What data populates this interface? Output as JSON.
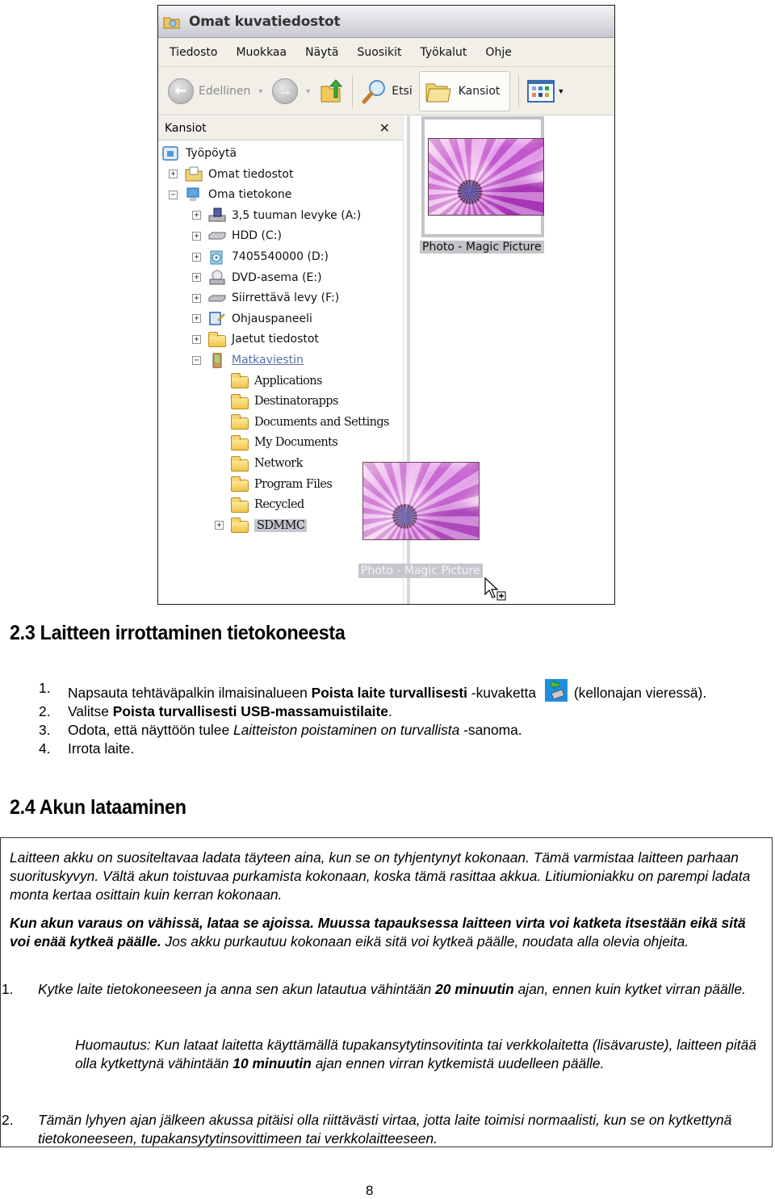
{
  "explorer": {
    "window_title": "Omat kuvatiedostot",
    "menu": [
      "Tiedosto",
      "Muokkaa",
      "Näytä",
      "Suosikit",
      "Työkalut",
      "Ohje"
    ],
    "toolbar": {
      "back_label": "Edellinen",
      "search_label": "Etsi",
      "folders_label": "Kansiot",
      "icons": [
        "back-arrow-icon",
        "forward-arrow-icon",
        "folder-up-icon",
        "search-magnifier-icon",
        "folders-icon",
        "views-icon"
      ]
    },
    "folder_pane": {
      "title": "Kansiot",
      "close_symbol": "✕",
      "tree": [
        {
          "label": "Työpöytä",
          "level": 0,
          "expander": "",
          "icon": "desktop-icon"
        },
        {
          "label": "Omat tiedostot",
          "level": 1,
          "expander": "+",
          "icon": "my-documents-icon"
        },
        {
          "label": "Oma tietokone",
          "level": 1,
          "expander": "−",
          "icon": "my-computer-icon"
        },
        {
          "label": "3,5 tuuman levyke (A:)",
          "level": 2,
          "expander": "+",
          "icon": "floppy-drive-icon"
        },
        {
          "label": "HDD (C:)",
          "level": 2,
          "expander": "+",
          "icon": "hard-drive-icon"
        },
        {
          "label": "7405540000 (D:)",
          "level": 2,
          "expander": "+",
          "icon": "cd-drive-icon"
        },
        {
          "label": "DVD-asema (E:)",
          "level": 2,
          "expander": "+",
          "icon": "dvd-drive-icon"
        },
        {
          "label": "Siirrettävä levy (F:)",
          "level": 2,
          "expander": "+",
          "icon": "removable-drive-icon"
        },
        {
          "label": "Ohjauspaneeli",
          "level": 2,
          "expander": "+",
          "icon": "control-panel-icon"
        },
        {
          "label": "Jaetut tiedostot",
          "level": 2,
          "expander": "+",
          "icon": "folder-icon"
        },
        {
          "label": "Matkaviestin",
          "level": 2,
          "expander": "−",
          "icon": "mobile-device-icon"
        },
        {
          "label": "Applications",
          "level": 3,
          "expander": "",
          "icon": "folder-icon"
        },
        {
          "label": "Destinatorapps",
          "level": 3,
          "expander": "",
          "icon": "folder-icon"
        },
        {
          "label": "Documents and Settings",
          "level": 3,
          "expander": "",
          "icon": "folder-icon"
        },
        {
          "label": "My Documents",
          "level": 3,
          "expander": "",
          "icon": "folder-icon"
        },
        {
          "label": "Network",
          "level": 3,
          "expander": "",
          "icon": "folder-icon"
        },
        {
          "label": "Program Files",
          "level": 3,
          "expander": "",
          "icon": "folder-icon"
        },
        {
          "label": "Recycled",
          "level": 3,
          "expander": "",
          "icon": "folder-icon"
        },
        {
          "label": "SDMMC",
          "level": 3,
          "expander": "+",
          "icon": "folder-icon",
          "selected": true
        }
      ]
    },
    "file_thumbnail": {
      "label": "Photo - Magic Picture"
    },
    "drag_ghost": {
      "label": "Photo - Magic Picture"
    }
  },
  "section_23": {
    "heading": "2.3 Laitteen irrottaminen tietokoneesta",
    "steps": [
      {
        "num": "1.",
        "pre": "Napsauta tehtäväpalkin ilmaisinalueen ",
        "bold": "Poista laite turvallisesti",
        "post": " -kuvaketta",
        "after_icon": "(kellonajan vieressä).",
        "icon": "safely-remove-hardware-icon"
      },
      {
        "num": "2.",
        "pre": "Valitse ",
        "bold": "Poista turvallisesti USB-massamuistilaite",
        "post": "."
      },
      {
        "num": "3.",
        "pre": "Odota, että näyttöön tulee ",
        "italic": "Laitteiston poistaminen on turvallista",
        "post": " -sanoma."
      },
      {
        "num": "4.",
        "pre": "Irrota laite."
      }
    ]
  },
  "section_24": {
    "heading": "2.4 Akun lataaminen",
    "para1": "Laitteen akku on suositeltavaa ladata täyteen aina, kun se on tyhjentynyt kokonaan. Tämä varmistaa laitteen parhaan suorituskyvyn. Vältä akun toistuvaa purkamista kokonaan, koska tämä rasittaa akkua. Litiumioniakku on parempi ladata monta kertaa osittain kuin kerran kokonaan.",
    "para2_bold": "Kun akun varaus on vähissä, lataa se ajoissa. Muussa tapauksessa laitteen virta voi katketa itsestään eikä sitä voi enää kytkeä päälle.",
    "para2_rest": "  Jos akku purkautuu kokonaan eikä sitä voi kytkeä päälle, noudata alla olevia ohjeita.",
    "step1": {
      "num": "1.",
      "pre": "Kytke laite tietokoneeseen ja anna sen akun latautua vähintään ",
      "bold": "20 minuutin",
      "post": " ajan, ennen kuin kytket virran päälle."
    },
    "note": {
      "pre": "Huomautus: Kun lataat laitetta käyttämällä tupakansytytinsovitinta tai verkkolaitetta (lisävaruste), laitteen pitää olla kytkettynä vähintään ",
      "bold": "10 minuutin",
      "post": " ajan ennen virran kytkemistä uudelleen päälle."
    },
    "step2": {
      "num": "2.",
      "text": "Tämän lyhyen ajan jälkeen akussa pitäisi olla riittävästi virtaa, jotta laite toimisi normaalisti, kun se on kytkettynä tietokoneeseen, tupakansytytinsovittimeen tai verkkolaitteeseen."
    }
  },
  "page_number": "8"
}
